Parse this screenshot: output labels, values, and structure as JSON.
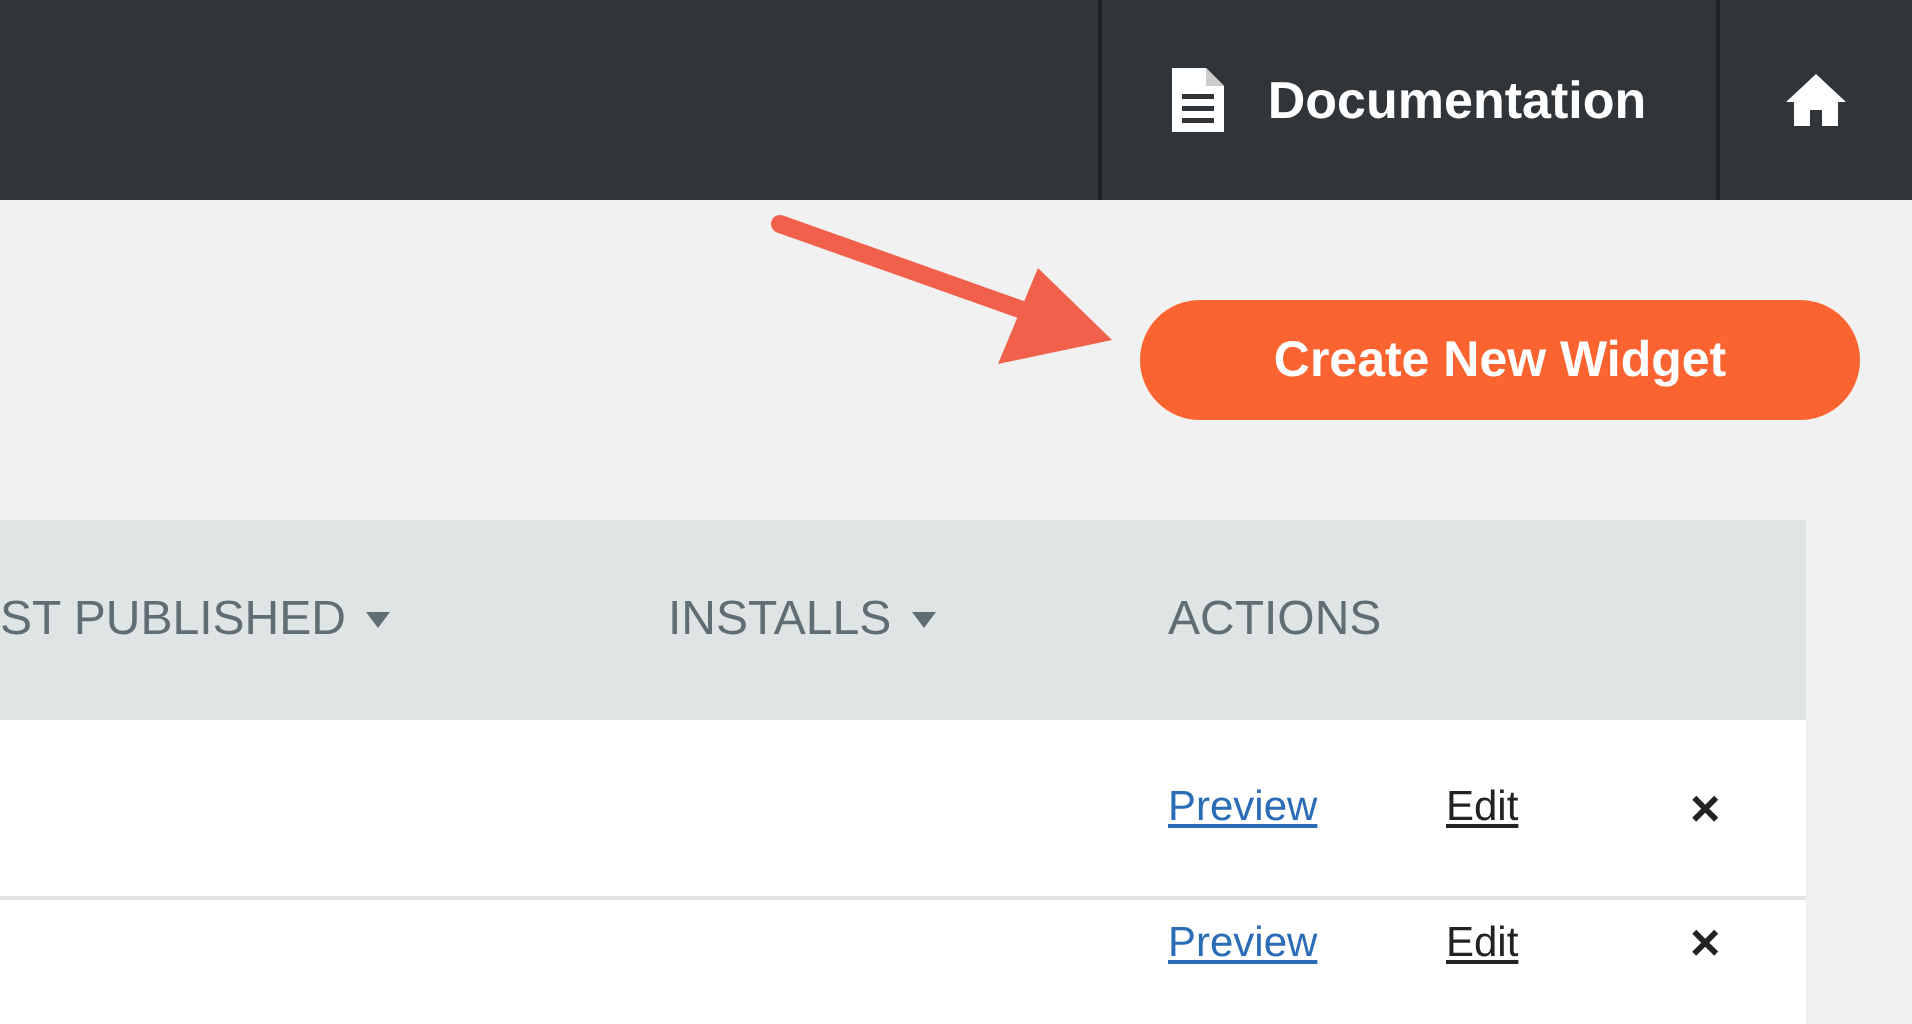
{
  "top_bar": {
    "documentation_link": "Documentation"
  },
  "create_button": "Create New Widget",
  "table": {
    "columns": [
      {
        "label": "ST PUBLISHED",
        "sortable": true
      },
      {
        "label": "INSTALLS",
        "sortable": true
      },
      {
        "label": "ACTIONS",
        "sortable": false
      }
    ],
    "rows": [
      {
        "preview": "Preview",
        "edit": "Edit",
        "delete": "×"
      },
      {
        "preview": "Preview",
        "edit": "Edit",
        "delete": "×"
      }
    ]
  }
}
